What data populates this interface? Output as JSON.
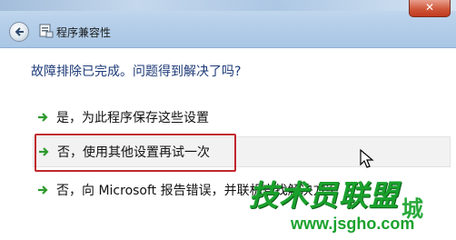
{
  "window": {
    "title": "程序兼容性",
    "close_label": "✕"
  },
  "main": {
    "heading": "故障排除已完成。问题得到解决了吗?",
    "options": [
      {
        "label": "是，为此程序保存这些设置"
      },
      {
        "label": "否，使用其他设置再试一次"
      },
      {
        "label": "否，向 Microsoft 报告错误，并联机查找解决方案"
      }
    ]
  },
  "watermark": {
    "logo": "技术员联盟",
    "url": "www.jsgho.com",
    "suffix": "城"
  },
  "colors": {
    "accent": "#1e3a78",
    "highlight": "#c0272d",
    "arrow": "#2e9a2e",
    "watermark": "#1aa12c"
  },
  "icons": [
    "back-arrow-icon",
    "app-icon",
    "arrow-right-icon",
    "mouse-cursor-icon"
  ]
}
